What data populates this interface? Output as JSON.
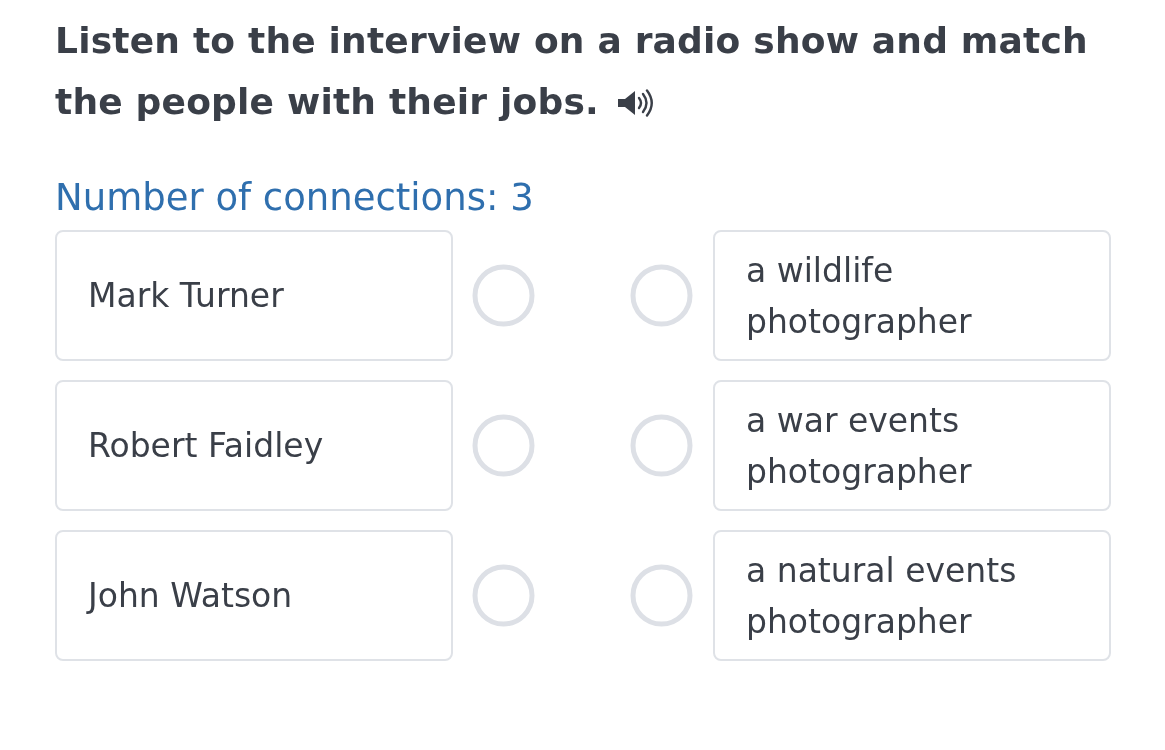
{
  "instruction": {
    "lines": [
      "Listen to the interview on a radio show and match",
      "the people with their jobs."
    ]
  },
  "connections_label": "Number of connections: 3",
  "rows": [
    {
      "person": "Mark Turner",
      "job": "a wildlife photographer"
    },
    {
      "person": "Robert Faidley",
      "job": "a war events photographer"
    },
    {
      "person": "John Watson",
      "job": "a natural events photographer"
    }
  ]
}
